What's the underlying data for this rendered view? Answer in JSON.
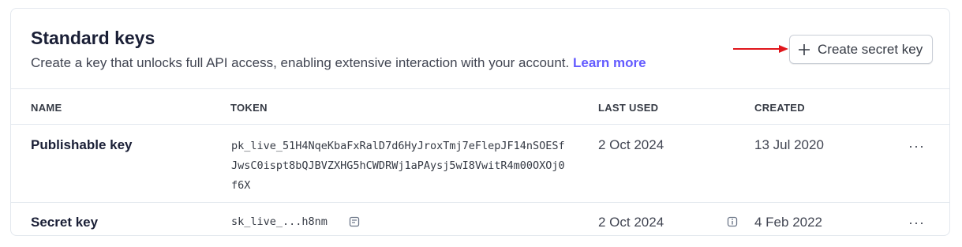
{
  "header": {
    "title": "Standard keys",
    "subtitle": "Create a key that unlocks full API access, enabling extensive interaction with your account.",
    "learn_more": "Learn more",
    "create_button": "Create secret key"
  },
  "table": {
    "columns": [
      "NAME",
      "TOKEN",
      "LAST USED",
      "CREATED"
    ],
    "rows": [
      {
        "name": "Publishable key",
        "token": "pk_live_51H4NqeKbaFxRalD7d6HyJroxTmj7eFlepJF14nSOESfJwsC0ispt8bQJBVZXHG5hCWDRWj1aPAysj5wI8VwitR4m00OXOj0f6X",
        "last_used": "2 Oct 2024",
        "created": "13 Jul 2020",
        "more": "···"
      },
      {
        "name": "Secret key",
        "token": "sk_live_...h8nm",
        "last_used": "2 Oct 2024",
        "created": "4 Feb 2022",
        "more": "···"
      }
    ]
  },
  "icons": {
    "create": "plus-icon",
    "copy": "copy-icon",
    "info": "info-icon",
    "more": "more-horizontal-icon",
    "annotation": "red-arrow-icon"
  },
  "colors": {
    "accent": "#635bff",
    "annotation_arrow": "#e0161c",
    "border": "#e3e8ee"
  }
}
